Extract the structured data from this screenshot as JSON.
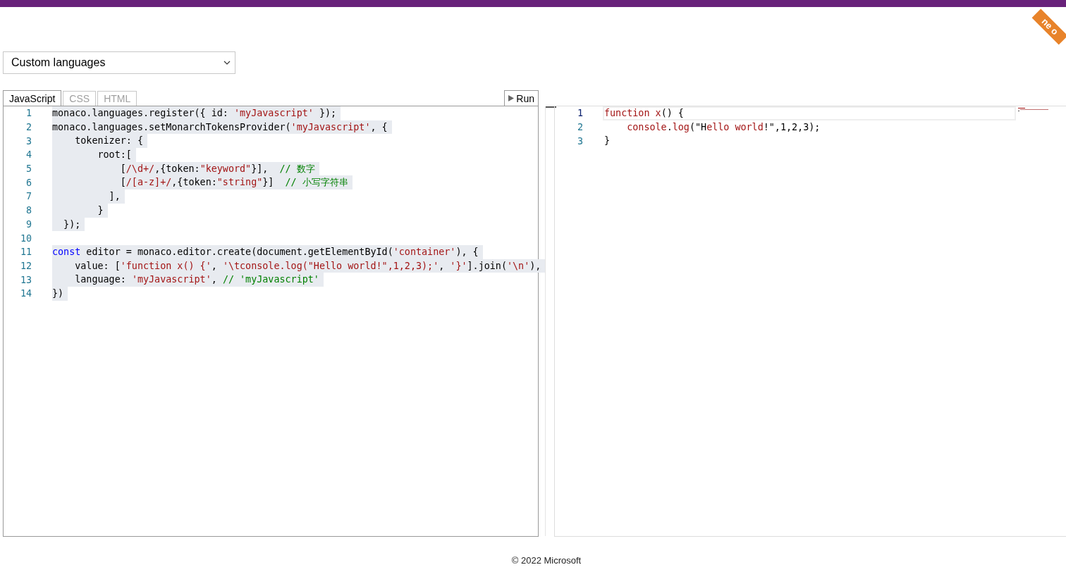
{
  "ribbon": {
    "text": "ne o"
  },
  "example_select": {
    "value": "Custom languages"
  },
  "tabs": [
    {
      "label": "JavaScript",
      "selected": true
    },
    {
      "label": "CSS",
      "selected": false
    },
    {
      "label": "HTML",
      "selected": false
    }
  ],
  "run_button": {
    "label": "Run"
  },
  "source_editor": {
    "lines": [
      {
        "number": "1",
        "tokens": [
          {
            "text": "monaco.languages.register({ id: ",
            "kind": "plain"
          },
          {
            "text": "'myJavascript'",
            "kind": "string"
          },
          {
            "text": " });",
            "kind": "plain"
          }
        ]
      },
      {
        "number": "2",
        "tokens": [
          {
            "text": "monaco.languages.setMonarchTokensProvider(",
            "kind": "plain"
          },
          {
            "text": "'myJavascript'",
            "kind": "string"
          },
          {
            "text": ", {",
            "kind": "plain"
          }
        ]
      },
      {
        "number": "3",
        "tokens": [
          {
            "text": "    tokenizer: {",
            "kind": "plain"
          }
        ]
      },
      {
        "number": "4",
        "tokens": [
          {
            "text": "        root:[",
            "kind": "plain"
          }
        ]
      },
      {
        "number": "5",
        "tokens": [
          {
            "text": "            [",
            "kind": "plain"
          },
          {
            "text": "/\\d+/",
            "kind": "string"
          },
          {
            "text": ",{token:",
            "kind": "plain"
          },
          {
            "text": "\"keyword\"",
            "kind": "string"
          },
          {
            "text": "}],  ",
            "kind": "plain"
          },
          {
            "text": "// 数字",
            "kind": "comment"
          }
        ]
      },
      {
        "number": "6",
        "tokens": [
          {
            "text": "            [",
            "kind": "plain"
          },
          {
            "text": "/[a-z]+/",
            "kind": "string"
          },
          {
            "text": ",{token:",
            "kind": "plain"
          },
          {
            "text": "\"string\"",
            "kind": "string"
          },
          {
            "text": "}]  ",
            "kind": "plain"
          },
          {
            "text": "// 小写字符串",
            "kind": "comment"
          }
        ]
      },
      {
        "number": "7",
        "tokens": [
          {
            "text": "          ],",
            "kind": "plain"
          }
        ]
      },
      {
        "number": "8",
        "tokens": [
          {
            "text": "        }",
            "kind": "plain"
          }
        ]
      },
      {
        "number": "9",
        "tokens": [
          {
            "text": "  });",
            "kind": "plain"
          }
        ]
      },
      {
        "number": "10"
      },
      {
        "number": "11",
        "tokens": [
          {
            "text": "const",
            "kind": "keyword"
          },
          {
            "text": " editor = monaco.editor.create(document.getElementById(",
            "kind": "plain"
          },
          {
            "text": "'container'",
            "kind": "string"
          },
          {
            "text": "), {",
            "kind": "plain"
          }
        ]
      },
      {
        "number": "12",
        "tokens": [
          {
            "text": "    value: [",
            "kind": "plain"
          },
          {
            "text": "'function x() {'",
            "kind": "string"
          },
          {
            "text": ", ",
            "kind": "plain"
          },
          {
            "text": "'\\tconsole.log(\"Hello world!\",1,2,3);'",
            "kind": "string"
          },
          {
            "text": ", ",
            "kind": "plain"
          },
          {
            "text": "'}'",
            "kind": "string"
          },
          {
            "text": "].join(",
            "kind": "plain"
          },
          {
            "text": "'\\n'",
            "kind": "string"
          },
          {
            "text": "),",
            "kind": "plain"
          }
        ]
      },
      {
        "number": "13",
        "tokens": [
          {
            "text": "    language: ",
            "kind": "plain"
          },
          {
            "text": "'myJavascript'",
            "kind": "string"
          },
          {
            "text": ", ",
            "kind": "plain"
          },
          {
            "text": "// 'myJavascript'",
            "kind": "comment"
          }
        ]
      },
      {
        "number": "14",
        "tokens": [
          {
            "text": "})",
            "kind": "plain"
          }
        ]
      }
    ]
  },
  "preview_editor": {
    "lines": [
      {
        "number": "1",
        "current": true,
        "tokens": [
          {
            "text": "function x",
            "kind": "string"
          },
          {
            "text": "() {",
            "kind": "plain"
          }
        ]
      },
      {
        "number": "2",
        "current": false,
        "tokens": [
          {
            "text": "    console",
            "kind": "string"
          },
          {
            "text": ".",
            "kind": "plain"
          },
          {
            "text": "log",
            "kind": "string"
          },
          {
            "text": "(\"H",
            "kind": "plain"
          },
          {
            "text": "ello world",
            "kind": "string"
          },
          {
            "text": "!\",1,2,3);",
            "kind": "plain"
          }
        ]
      },
      {
        "number": "3",
        "current": false,
        "tokens": [
          {
            "text": "}",
            "kind": "plain"
          }
        ]
      }
    ]
  },
  "footer": {
    "text": "© 2022 Microsoft"
  }
}
